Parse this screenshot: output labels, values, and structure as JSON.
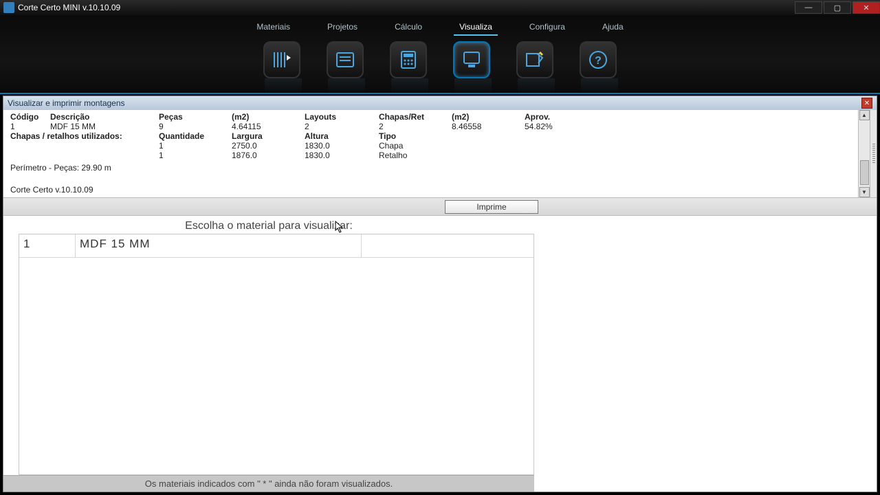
{
  "window": {
    "title": "Corte Certo  MINI  v.10.10.09"
  },
  "menu": {
    "items": [
      "Materiais",
      "Projetos",
      "Cálculo",
      "Visualiza",
      "Configura",
      "Ajuda"
    ],
    "active_index": 3
  },
  "toolbar_icons": [
    "materiais-icon",
    "projetos-icon",
    "calculo-icon",
    "visualiza-icon",
    "configura-icon",
    "ajuda-icon"
  ],
  "subwindow": {
    "title": "Visualizar e imprimir montagens"
  },
  "info": {
    "headers1": {
      "codigo": "Código",
      "descricao": "Descrição",
      "pecas": "Peças",
      "m2": "(m2)",
      "layouts": "Layouts",
      "chapas_ret": "Chapas/Ret",
      "m2b": "(m2)",
      "aprov": "Aprov."
    },
    "row1": {
      "codigo": "1",
      "descricao": "MDF 15 MM",
      "pecas": "9",
      "m2": "4.64115",
      "layouts": "2",
      "chapas_ret": "2",
      "m2b": "8.46558",
      "aprov": "54.82%"
    },
    "headers2": {
      "label": "Chapas / retalhos utilizados:",
      "qtd": "Quantidade",
      "larg": "Largura",
      "alt": "Altura",
      "tipo": "Tipo"
    },
    "rows2": [
      {
        "qtd": "1",
        "larg": "2750.0",
        "alt": "1830.0",
        "tipo": "Chapa"
      },
      {
        "qtd": "1",
        "larg": "1876.0",
        "alt": "1830.0",
        "tipo": "Retalho"
      }
    ],
    "perimetro": "Perímetro - Peças: 29.90 m",
    "appver": "Corte Certo  v.10.10.09"
  },
  "print_button": "Imprime",
  "material_picker": {
    "title": "Escolha o material para visualizar:",
    "rows": [
      {
        "id": "1",
        "name": "MDF 15 MM"
      }
    ],
    "footer": "Os materiais indicados com \" * \"  ainda não foram visualizados."
  }
}
